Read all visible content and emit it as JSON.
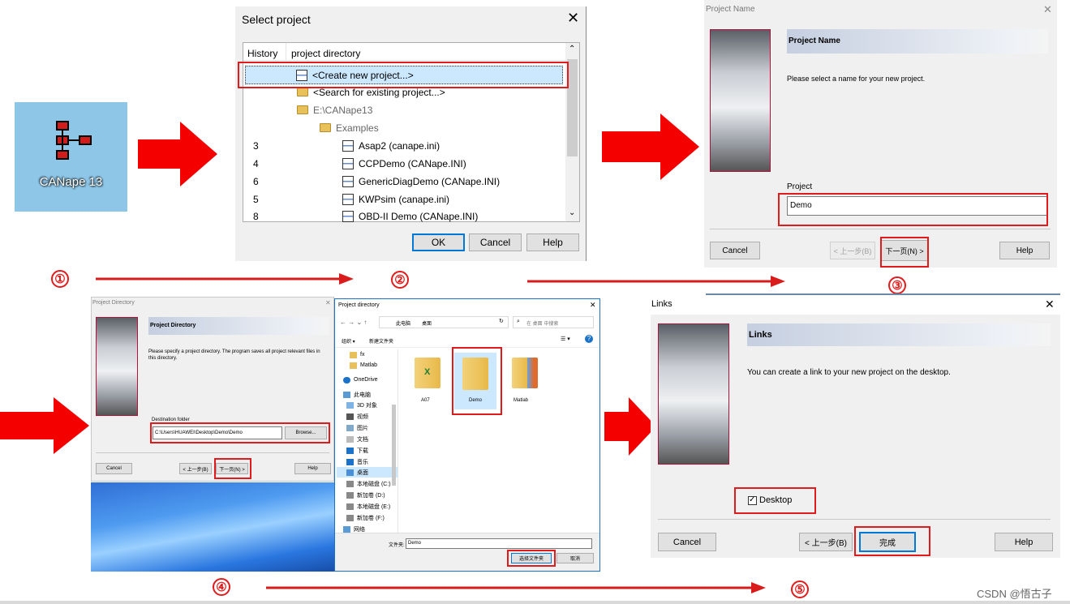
{
  "desktop_icon": {
    "label": "CANape 13"
  },
  "select_project": {
    "title": "Select project",
    "col_history": "History",
    "col_dir": "project directory",
    "rows": [
      {
        "num": "",
        "label": "<Create new project...>"
      },
      {
        "num": "",
        "label": "<Search for existing project...>"
      },
      {
        "num": "",
        "label": "E:\\CANape13"
      },
      {
        "num": "",
        "label": "Examples"
      },
      {
        "num": "3",
        "label": "Asap2  (canape.ini)"
      },
      {
        "num": "4",
        "label": "CCPDemo  (CANape.INI)"
      },
      {
        "num": "6",
        "label": "GenericDiagDemo  (CANape.INI)"
      },
      {
        "num": "5",
        "label": "KWPsim  (canape.ini)"
      },
      {
        "num": "8",
        "label": "OBD-II Demo  (CANape.INI)"
      }
    ],
    "ok": "OK",
    "cancel": "Cancel",
    "help": "Help"
  },
  "project_name": {
    "title": "Project Name",
    "heading": "Project Name",
    "desc": "Please select a name for your new project.",
    "field_label": "Project",
    "field_value": "Demo",
    "cancel": "Cancel",
    "back": "< 上一步(B)",
    "next": "下一页(N) >",
    "help": "Help"
  },
  "project_directory": {
    "title": "Project Directory",
    "heading": "Project Directory",
    "desc": "Please specify a project directory. The program saves all project relevant files in this directory.",
    "field_label": "Destination folder",
    "field_value": "C:\\Users\\HUAWEI\\Desktop\\Demo\\Demo",
    "browse": "Browse...",
    "cancel": "Cancel",
    "back": "< 上一步(B)",
    "next": "下一页(N) >",
    "help": "Help"
  },
  "file_picker": {
    "title": "Project directory",
    "path": [
      "此电脑",
      "桌面"
    ],
    "search_placeholder": "在 桌面 中搜索",
    "organize": "组织 ▾",
    "new_folder": "新建文件夹",
    "nav_items": [
      "fx",
      "Matlab",
      "OneDrive",
      "此电脑",
      "3D 对象",
      "视频",
      "图片",
      "文档",
      "下载",
      "音乐",
      "桌面",
      "本地磁盘 (C:)",
      "新加卷 (D:)",
      "本地磁盘 (E:)",
      "新加卷 (F:)",
      "网络"
    ],
    "files": [
      "A07",
      "Demo",
      "Matlab"
    ],
    "folder_label": "文件夹:",
    "folder_value": "Demo",
    "select_btn": "选择文件夹",
    "cancel_btn": "取消"
  },
  "links": {
    "title": "Links",
    "heading": "Links",
    "desc": "You can create a link to your new project on the desktop.",
    "checkbox_label": "Desktop",
    "cancel": "Cancel",
    "back": "< 上一步(B)",
    "finish": "完成",
    "help": "Help"
  },
  "steps": [
    "①",
    "②",
    "③",
    "④",
    "⑤"
  ],
  "watermark": "CSDN @悟古子",
  "colors": {
    "highlight": "#e11b1b",
    "arrow": "#f40000",
    "desktop_tile": "#8ec6e8"
  }
}
